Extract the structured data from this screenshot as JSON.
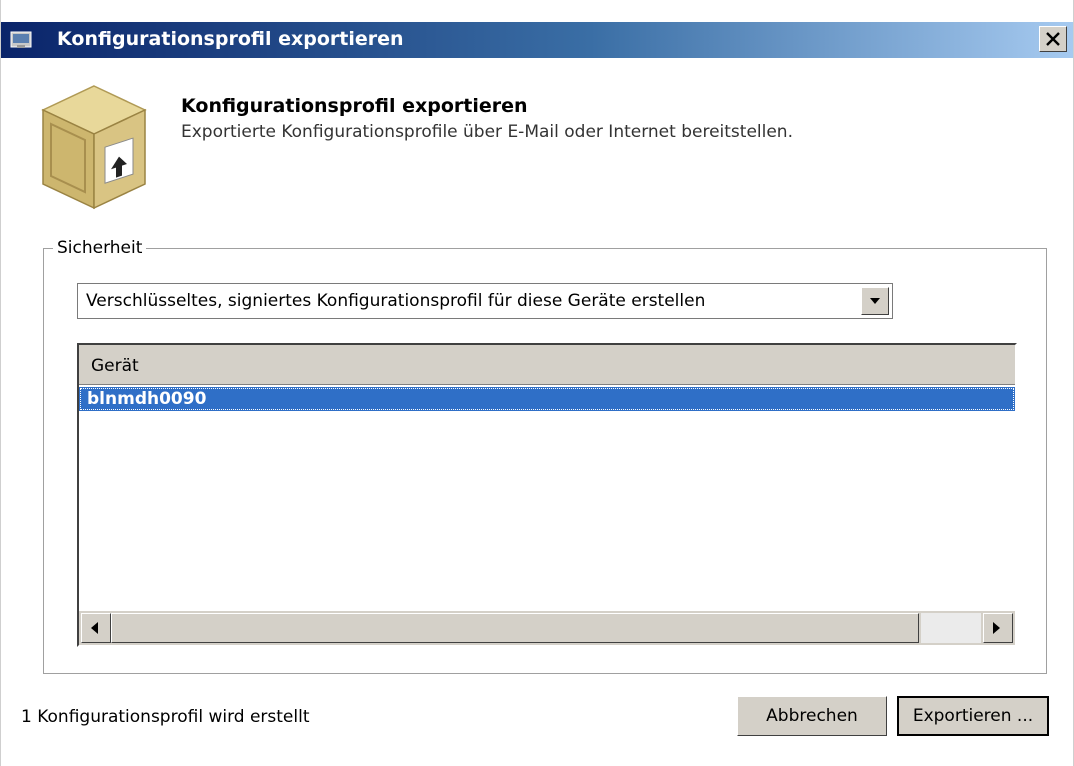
{
  "window": {
    "title": "Konfigurationsprofil exportieren"
  },
  "header": {
    "title": "Konfigurationsprofil exportieren",
    "subtitle": "Exportierte Konfigurationsprofile über E-Mail oder Internet bereitstellen."
  },
  "security": {
    "legend": "Sicherheit",
    "select_value": "Verschlüsseltes, signiertes Konfigurationsprofil für diese Geräte erstellen"
  },
  "devices": {
    "column_header": "Gerät",
    "rows": [
      "blnmdh0090"
    ],
    "selected_index": 0
  },
  "status": "1 Konfigurationsprofil wird erstellt",
  "buttons": {
    "cancel": "Abbrechen",
    "export": "Exportieren ..."
  },
  "icons": {
    "title": "app-icon",
    "header": "export-box-icon",
    "close": "close-icon",
    "dropdown": "chevron-down-icon",
    "scroll_left": "arrow-left-icon",
    "scroll_right": "arrow-right-icon"
  },
  "colors": {
    "titlebar_start": "#0a246a",
    "titlebar_end": "#a6caf0",
    "selection": "#2f6fc7"
  }
}
